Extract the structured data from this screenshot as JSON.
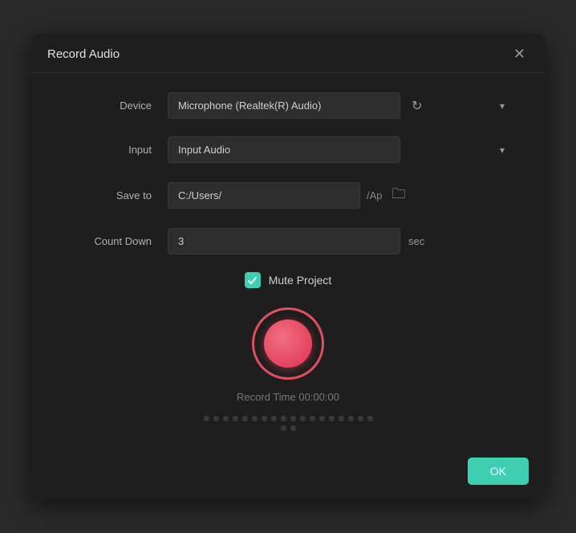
{
  "dialog": {
    "title": "Record Audio",
    "close_label": "✕"
  },
  "form": {
    "device_label": "Device",
    "device_value": "Microphone (Realtek(R) Audio)",
    "device_options": [
      "Microphone (Realtek(R) Audio)"
    ],
    "input_label": "Input",
    "input_value": "Input Audio",
    "input_options": [
      "Input Audio"
    ],
    "save_label": "Save to",
    "save_path": "C:/Users/",
    "save_suffix": "/Ap",
    "countdown_label": "Count Down",
    "countdown_value": "3",
    "sec_label": "sec",
    "mute_label": "Mute Project",
    "mute_checked": true
  },
  "record": {
    "time_label": "Record Time 00:00:00",
    "dot_count": 20
  },
  "footer": {
    "ok_label": "OK"
  }
}
